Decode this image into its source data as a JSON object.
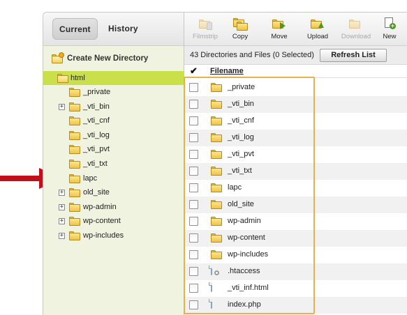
{
  "tabs": {
    "current": "Current",
    "history": "History"
  },
  "sidebar": {
    "create_dir_label": "Create New Directory",
    "tree": [
      {
        "label": "html",
        "level": 0,
        "expand": false,
        "selected": true,
        "open": true
      },
      {
        "label": "_private",
        "level": 1,
        "expand": false
      },
      {
        "label": "_vti_bin",
        "level": 1,
        "expand": true
      },
      {
        "label": "_vti_cnf",
        "level": 1,
        "expand": false
      },
      {
        "label": "_vti_log",
        "level": 1,
        "expand": false
      },
      {
        "label": "_vti_pvt",
        "level": 1,
        "expand": false
      },
      {
        "label": "_vti_txt",
        "level": 1,
        "expand": false
      },
      {
        "label": "lapc",
        "level": 1,
        "expand": false
      },
      {
        "label": "old_site",
        "level": 1,
        "expand": true
      },
      {
        "label": "wp-admin",
        "level": 1,
        "expand": true
      },
      {
        "label": "wp-content",
        "level": 1,
        "expand": true
      },
      {
        "label": "wp-includes",
        "level": 1,
        "expand": true
      }
    ]
  },
  "toolbar": {
    "filmstrip": "Filmstrip",
    "copy": "Copy",
    "move": "Move",
    "upload": "Upload",
    "download": "Download",
    "new": "New"
  },
  "status": {
    "summary": "43 Directories and Files (0 Selected)",
    "refresh_label": "Refresh List"
  },
  "table": {
    "check_all_glyph": "✔",
    "header_filename": "Filename",
    "rows": [
      {
        "name": "_private",
        "icon": "folder"
      },
      {
        "name": "_vti_bin",
        "icon": "folder"
      },
      {
        "name": "_vti_cnf",
        "icon": "folder"
      },
      {
        "name": "_vti_log",
        "icon": "folder"
      },
      {
        "name": "_vti_pvt",
        "icon": "folder"
      },
      {
        "name": "_vti_txt",
        "icon": "folder"
      },
      {
        "name": "lapc",
        "icon": "folder"
      },
      {
        "name": "old_site",
        "icon": "folder"
      },
      {
        "name": "wp-admin",
        "icon": "folder"
      },
      {
        "name": "wp-content",
        "icon": "folder"
      },
      {
        "name": "wp-includes",
        "icon": "folder"
      },
      {
        "name": ".htaccess",
        "icon": "settings-file"
      },
      {
        "name": "_vti_inf.html",
        "icon": "html-file"
      },
      {
        "name": "index.php",
        "icon": "php-file"
      }
    ]
  },
  "colors": {
    "selected_tree_node": "#c9e04a",
    "sidebar_bg": "#f0f3e0",
    "highlight_border": "#e8b04a",
    "annotation_arrow": "#c0111b"
  }
}
